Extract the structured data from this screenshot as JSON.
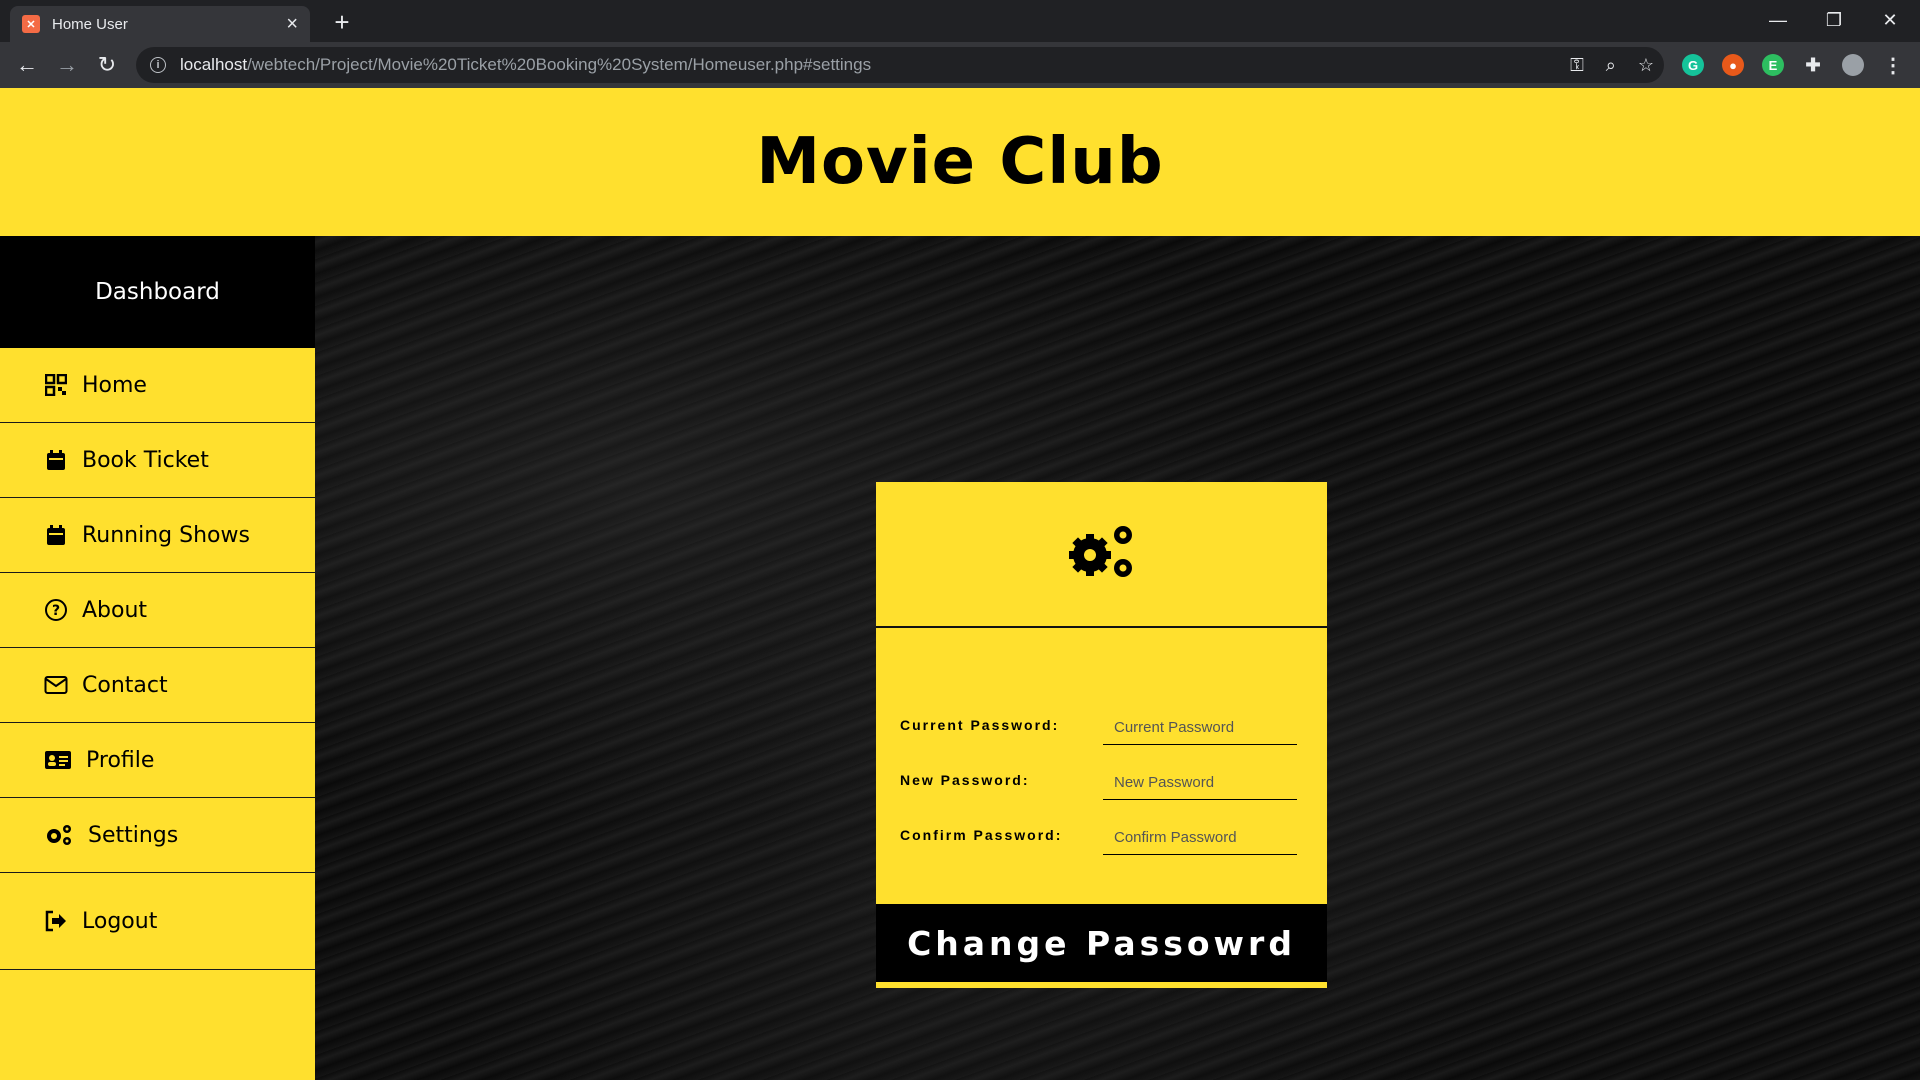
{
  "browser": {
    "tab_title": "Home User",
    "url_host": "localhost",
    "url_path": "/webtech/Project/Movie%20Ticket%20Booking%20System/Homeuser.php#settings"
  },
  "header": {
    "title": "Movie Club"
  },
  "sidebar": {
    "dashboard_label": "Dashboard",
    "items": [
      {
        "label": "Home",
        "icon": "grid-icon"
      },
      {
        "label": "Book Ticket",
        "icon": "calendar-icon"
      },
      {
        "label": "Running Shows",
        "icon": "calendar-icon"
      },
      {
        "label": "About",
        "icon": "question-circle-icon"
      },
      {
        "label": "Contact",
        "icon": "envelope-icon"
      },
      {
        "label": "Profile",
        "icon": "id-card-icon"
      },
      {
        "label": "Settings",
        "icon": "cogs-icon"
      },
      {
        "label": "Logout",
        "icon": "sign-out-icon"
      }
    ]
  },
  "settings_form": {
    "current_label": "Current Password:",
    "current_placeholder": "Current Password",
    "new_label": "New Password:",
    "new_placeholder": "New Password",
    "confirm_label": "Confirm Password:",
    "confirm_placeholder": "Confirm Password",
    "submit_label": "Change Passowrd"
  },
  "colors": {
    "accent": "#ffe02e",
    "dark": "#000000"
  }
}
